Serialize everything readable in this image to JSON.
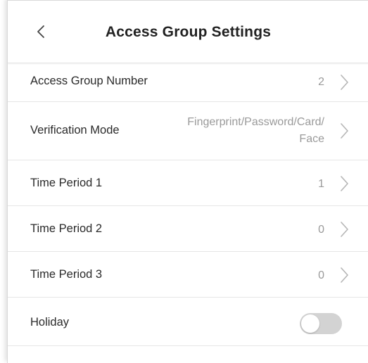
{
  "header": {
    "title": "Access Group Settings",
    "back_icon": "chevron-left-icon"
  },
  "rows": [
    {
      "label": "Access Group Number",
      "value": "2"
    },
    {
      "label": "Verification Mode",
      "value_line1": "Fingerprint/Password/Card/",
      "value_line2": "Face"
    },
    {
      "label": "Time Period 1",
      "value": "1"
    },
    {
      "label": "Time Period 2",
      "value": "0"
    },
    {
      "label": "Time Period 3",
      "value": "0"
    },
    {
      "label": "Holiday",
      "toggle_on": false
    }
  ],
  "colors": {
    "label": "#2a2a2a",
    "value": "#9a9a9a",
    "toggle_off": "#d3d3d3"
  }
}
